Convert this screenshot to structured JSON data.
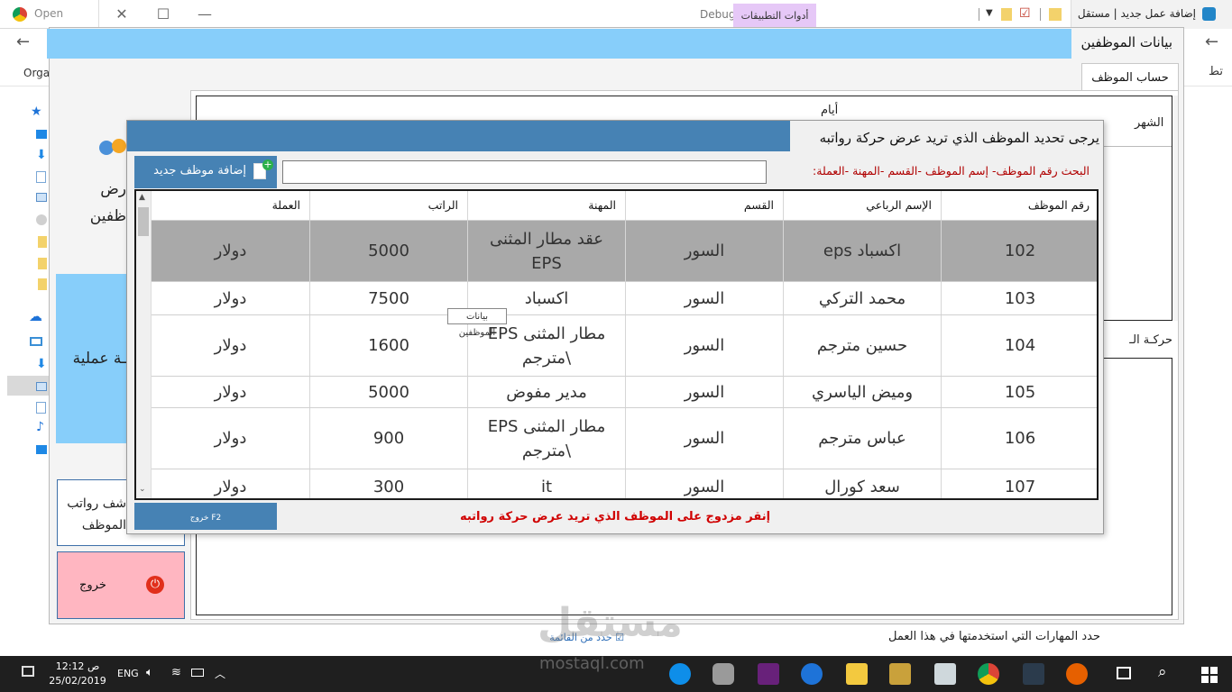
{
  "browser": {
    "tab_left": "Open",
    "tab_right": "إضافة عمل جديد | مستقل",
    "debug_label": "Debug",
    "tools_tab": "أدوات التطبيقات",
    "bookmark_left": "Orga",
    "bookmark_right": "تط"
  },
  "form": {
    "title": "بيانات الموظفين",
    "tab_label": "حساب الموظف",
    "month_header": "الشهر",
    "days_header": "أيام",
    "movement_label": "حركـة الـ",
    "skills_label": "حدد المهارات التي استخدمتها في هذا العمل",
    "select_list": "حدد من القائمة",
    "sidebar": {
      "view_line1": "رض",
      "view_line2": "ظفين",
      "operation": "ـة عملية",
      "payroll_line1": "شف رواتب",
      "payroll_line2": "الموظف",
      "exit": "خروج"
    }
  },
  "dialog": {
    "title": "يرجى تحديد الموظف الذي تريد عرض حركة رواتبه",
    "add_button": "إضافة موظف جديد",
    "search_label": "البحث رقم الموظف- إسم الموظف -القسم -المهنة -العملة:",
    "search_value": "",
    "hint": "إنقر مزدوج على الموظف الذي تريد عرض حركة رواتبه",
    "exit_button": "خروج F2",
    "tooltip": "بيانات الموظفين",
    "columns": [
      "رقم الموظف",
      "الإسم الرباعي",
      "القسم",
      "المهنة",
      "الراتب",
      "العملة"
    ],
    "rows": [
      {
        "id": "102",
        "name": "اكسباد eps",
        "dept": "السور",
        "job": "عقد مطار المثنى EPS",
        "salary": "5000",
        "currency": "دولار"
      },
      {
        "id": "103",
        "name": "محمد التركي",
        "dept": "السور",
        "job": "اكسباد",
        "salary": "7500",
        "currency": "دولار"
      },
      {
        "id": "104",
        "name": "حسين مترجم",
        "dept": "السور",
        "job": "مطار المثنى EPS \\مترجم",
        "salary": "1600",
        "currency": "دولار"
      },
      {
        "id": "105",
        "name": "وميض الياسري",
        "dept": "السور",
        "job": "مدير مفوض",
        "salary": "5000",
        "currency": "دولار"
      },
      {
        "id": "106",
        "name": "عباس مترجم",
        "dept": "السور",
        "job": "مطار المثنى EPS \\مترجم",
        "salary": "900",
        "currency": "دولار"
      },
      {
        "id": "107",
        "name": "سعد كورال",
        "dept": "السور",
        "job": "it",
        "salary": "300",
        "currency": "دولار"
      }
    ]
  },
  "taskbar": {
    "time": "12:12 ص",
    "date": "25/02/2019",
    "lang": "ENG"
  },
  "watermark": {
    "logo": "مستقل",
    "site": "mostaql.com"
  },
  "colors": {
    "title_bar": "#87cefa",
    "dialog_header": "#4682b4",
    "selected_row": "#a9a9a9",
    "exit_button": "#ffb6c1",
    "hint_text": "#d00000"
  }
}
